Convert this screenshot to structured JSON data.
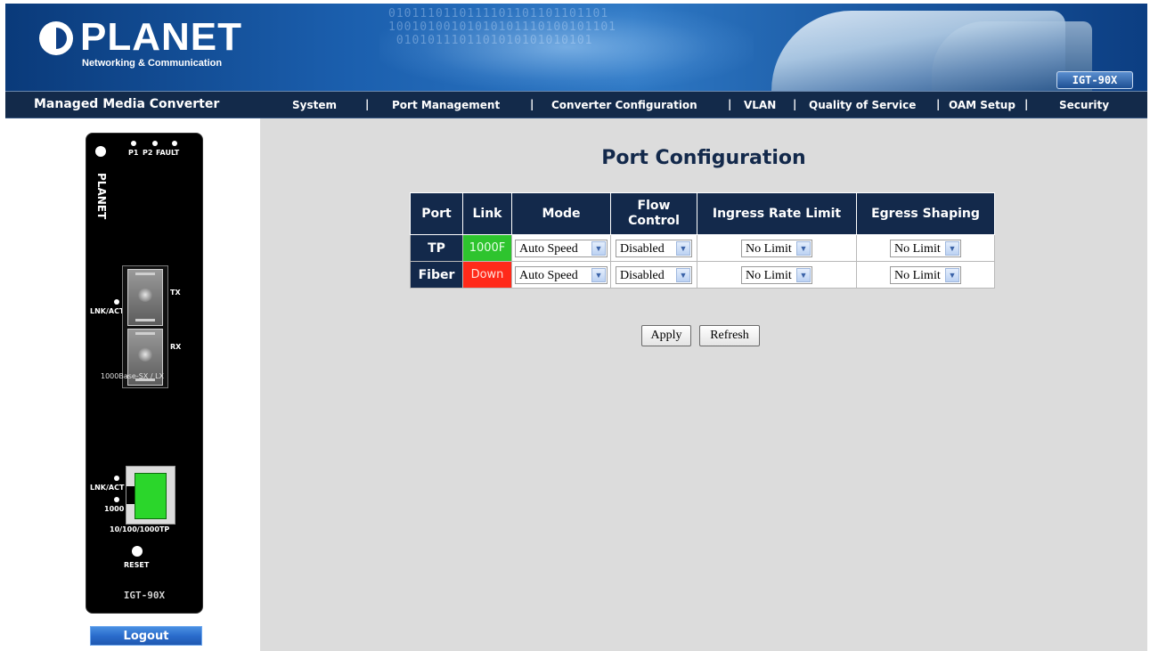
{
  "header": {
    "logo_name": "PLANET",
    "logo_tagline": "Networking & Communication",
    "model_badge": "IGT-90X"
  },
  "nav": {
    "brand": "Managed Media Converter",
    "items": [
      {
        "label": "System"
      },
      {
        "label": "Port Management"
      },
      {
        "label": "Converter Configuration"
      },
      {
        "label": "VLAN"
      },
      {
        "label": "Quality of Service"
      },
      {
        "label": "OAM Setup"
      },
      {
        "label": "Security"
      }
    ]
  },
  "device": {
    "led_p1": "P1",
    "led_p2": "P2",
    "led_fault": "FAULT",
    "logo_word": "PLANET",
    "sfp_lnk_label": "LNK/ACT",
    "sfp_tx": "TX",
    "sfp_rx": "RX",
    "sfp_type": "1000Base-SX / LX",
    "tp_lnk_label": "LNK/ACT",
    "tp_speed_label": "1000",
    "tp_type": "10/100/1000TP",
    "reset_label": "RESET",
    "model": "IGT-90X",
    "colors": {
      "body": "#000000",
      "tp_jack": "#2bd62b"
    }
  },
  "logout_label": "Logout",
  "page": {
    "title": "Port Configuration",
    "table": {
      "headers": {
        "port": "Port",
        "link": "Link",
        "mode": "Mode",
        "flow_line1": "Flow",
        "flow_line2": "Control",
        "ingress": "Ingress Rate Limit",
        "egress": "Egress Shaping"
      },
      "rows": [
        {
          "port": "TP",
          "link": "1000F",
          "link_status": "up",
          "mode": "Auto Speed",
          "flow": "Disabled",
          "ingress": "No Limit",
          "egress": "No Limit"
        },
        {
          "port": "Fiber",
          "link": "Down",
          "link_status": "down",
          "mode": "Auto Speed",
          "flow": "Disabled",
          "ingress": "No Limit",
          "egress": "No Limit"
        }
      ]
    },
    "buttons": {
      "apply": "Apply",
      "refresh": "Refresh"
    },
    "colors": {
      "header_navy": "#13294b",
      "link_up": "#2ec42e",
      "link_down": "#ff2a1a",
      "background": "#dcdcdc"
    }
  }
}
